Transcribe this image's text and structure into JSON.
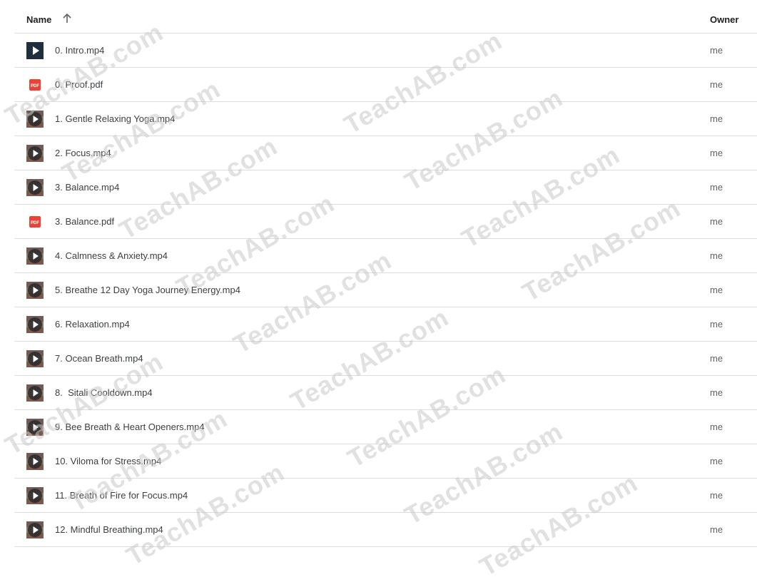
{
  "header": {
    "name_label": "Name",
    "owner_label": "Owner"
  },
  "rows": [
    {
      "name": "0. Intro.mp4",
      "owner": "me",
      "icon": "video-thumbnail-dark"
    },
    {
      "name": "0. Proof.pdf",
      "owner": "me",
      "icon": "pdf-icon"
    },
    {
      "name": "1. Gentle Relaxing Yoga.mp4",
      "owner": "me",
      "icon": "video-thumbnail"
    },
    {
      "name": "2. Focus.mp4",
      "owner": "me",
      "icon": "video-thumbnail"
    },
    {
      "name": "3. Balance.mp4",
      "owner": "me",
      "icon": "video-thumbnail"
    },
    {
      "name": "3. Balance.pdf",
      "owner": "me",
      "icon": "pdf-icon"
    },
    {
      "name": "4. Calmness & Anxiety.mp4",
      "owner": "me",
      "icon": "video-thumbnail"
    },
    {
      "name": "5. Breathe 12 Day Yoga Journey Energy.mp4",
      "owner": "me",
      "icon": "video-thumbnail"
    },
    {
      "name": "6. Relaxation.mp4",
      "owner": "me",
      "icon": "video-thumbnail"
    },
    {
      "name": "7. Ocean Breath.mp4",
      "owner": "me",
      "icon": "video-thumbnail"
    },
    {
      "name": "8.  Sitali Cooldown.mp4",
      "owner": "me",
      "icon": "video-thumbnail"
    },
    {
      "name": "9. Bee Breath & Heart Openers.mp4",
      "owner": "me",
      "icon": "video-thumbnail"
    },
    {
      "name": "10. Viloma for Stress.mp4",
      "owner": "me",
      "icon": "video-thumbnail"
    },
    {
      "name": "11. Breath of Fire for Focus.mp4",
      "owner": "me",
      "icon": "video-thumbnail"
    },
    {
      "name": "12. Mindful Breathing.mp4",
      "owner": "me",
      "icon": "video-thumbnail"
    }
  ],
  "watermark": "TeachAB.com",
  "colors": {
    "pdf_red": "#ea4335",
    "divider": "#dadce0",
    "video_dark": "#1e3040"
  }
}
